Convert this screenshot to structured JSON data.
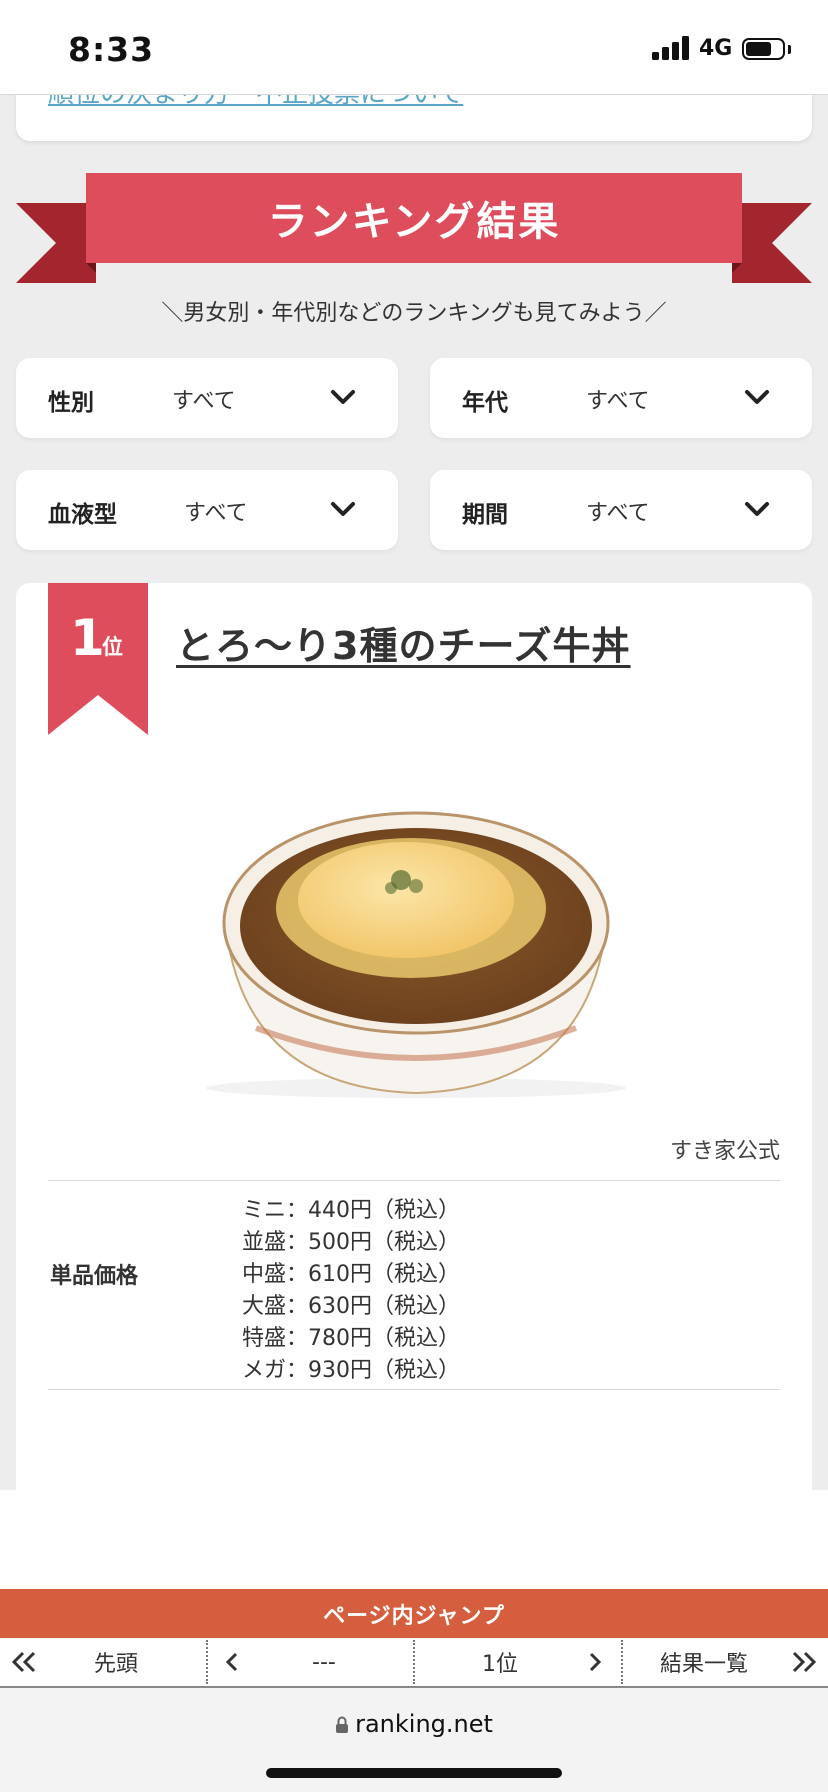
{
  "status": {
    "time": "8:33",
    "network": "4G"
  },
  "prev_section": {
    "link_text": "順位の決まり方・不正投票について"
  },
  "ranking_header": {
    "title": "ランキング結果",
    "subtitle": "＼男女別・年代別などのランキングも見てみよう／"
  },
  "filters": [
    {
      "label": "性別",
      "value": "すべて"
    },
    {
      "label": "年代",
      "value": "すべて"
    },
    {
      "label": "血液型",
      "value": "すべて"
    },
    {
      "label": "期間",
      "value": "すべて"
    }
  ],
  "item": {
    "rank_number": "1",
    "rank_unit": "位",
    "title": "とろ〜り3種のチーズ牛丼",
    "image_source": "すき家公式",
    "price_label": "単品価格",
    "prices": [
      "ミニ：440円（税込）",
      "並盛：500円（税込）",
      "中盛：610円（税込）",
      "大盛：630円（税込）",
      "特盛：780円（税込）",
      "メガ：930円（税込）"
    ]
  },
  "page_jump": {
    "title": "ページ内ジャンプ",
    "top_label": "先頭",
    "prev_label": "---",
    "current_label": "1位",
    "list_label": "結果一覧"
  },
  "browser": {
    "url": "ranking.net"
  },
  "colors": {
    "ribbon": "#de4d5c",
    "ribbon_dark": "#a3262f",
    "jump_bar": "#d45e3d",
    "link": "#5aa6c8"
  }
}
